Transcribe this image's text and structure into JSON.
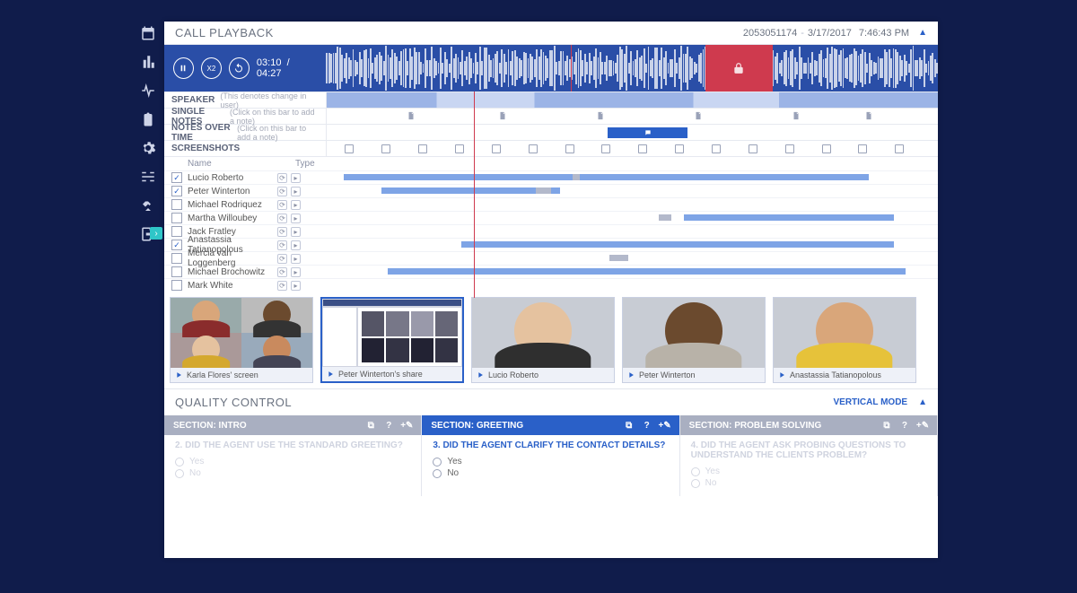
{
  "header": {
    "title": "CALL PLAYBACK",
    "call_id": "2053051174",
    "date": "3/17/2017",
    "time": "7:46:43 PM"
  },
  "player": {
    "current": "03:10",
    "total": "04:27",
    "speed": "X2"
  },
  "tracks": {
    "speaker": {
      "name": "SPEAKER",
      "hint": "(This denotes change in user)"
    },
    "single_notes": {
      "name": "SINGLE NOTES",
      "hint": "(Click on this bar to add a note)"
    },
    "notes_over_time": {
      "name": "NOTES OVER TIME",
      "hint": "(Click on this bar to add a note)"
    },
    "screenshots": {
      "name": "SCREENSHOTS"
    }
  },
  "part_header": {
    "name": "Name",
    "type": "Type"
  },
  "participants": [
    {
      "name": "Lucio Roberto",
      "checked": true,
      "bars": [
        [
          5,
          85,
          "b"
        ],
        [
          42,
          1.2,
          "g"
        ]
      ]
    },
    {
      "name": "Peter Winterton",
      "checked": true,
      "bars": [
        [
          11,
          29,
          "b"
        ],
        [
          36,
          2.5,
          "g"
        ]
      ]
    },
    {
      "name": "Michael Rodriquez",
      "checked": false,
      "bars": []
    },
    {
      "name": "Martha Willoubey",
      "checked": false,
      "bars": [
        [
          60,
          34,
          "b"
        ],
        [
          56,
          2,
          "g"
        ]
      ]
    },
    {
      "name": "Jack Fratley",
      "checked": false,
      "bars": []
    },
    {
      "name": "Anastassia Tatianopolous",
      "checked": true,
      "bars": [
        [
          24,
          70,
          "b"
        ]
      ]
    },
    {
      "name": "Mercia van Loggenberg",
      "checked": false,
      "bars": [
        [
          48,
          3,
          "g"
        ]
      ]
    },
    {
      "name": "Michael Brochowitz",
      "checked": false,
      "bars": [
        [
          12,
          84,
          "b"
        ]
      ]
    },
    {
      "name": "Mark White",
      "checked": false,
      "bars": []
    }
  ],
  "thumbs": [
    {
      "label": "Karla Flores' screen",
      "kind": "grid"
    },
    {
      "label": "Peter Winterton's share",
      "kind": "app",
      "selected": true
    },
    {
      "label": "Lucio Roberto",
      "kind": "person",
      "skin": "#e5c29f",
      "shirt": "#2f2f2f"
    },
    {
      "label": "Peter Winterton",
      "kind": "person",
      "skin": "#6b4a2e",
      "shirt": "#b8b2a8"
    },
    {
      "label": "Anastassia Tatianopolous",
      "kind": "person",
      "skin": "#d9a67a",
      "shirt": "#e6c23a"
    }
  ],
  "qc": {
    "title": "QUALITY CONTROL",
    "mode": "VERTICAL MODE",
    "sections": [
      {
        "title": "SECTION: INTRO",
        "question": "2. DID THE AGENT USE THE STANDARD GREETING?",
        "active": false
      },
      {
        "title": "SECTION: GREETING",
        "question": "3. DID THE AGENT CLARIFY THE CONTACT DETAILS?",
        "active": true
      },
      {
        "title": "SECTION: PROBLEM SOLVING",
        "question": "4. DID THE AGENT ASK PROBING QUESTIONS TO UNDERSTAND THE CLIENTS PROBLEM?",
        "active": false
      }
    ],
    "options": [
      "Yes",
      "No"
    ]
  }
}
